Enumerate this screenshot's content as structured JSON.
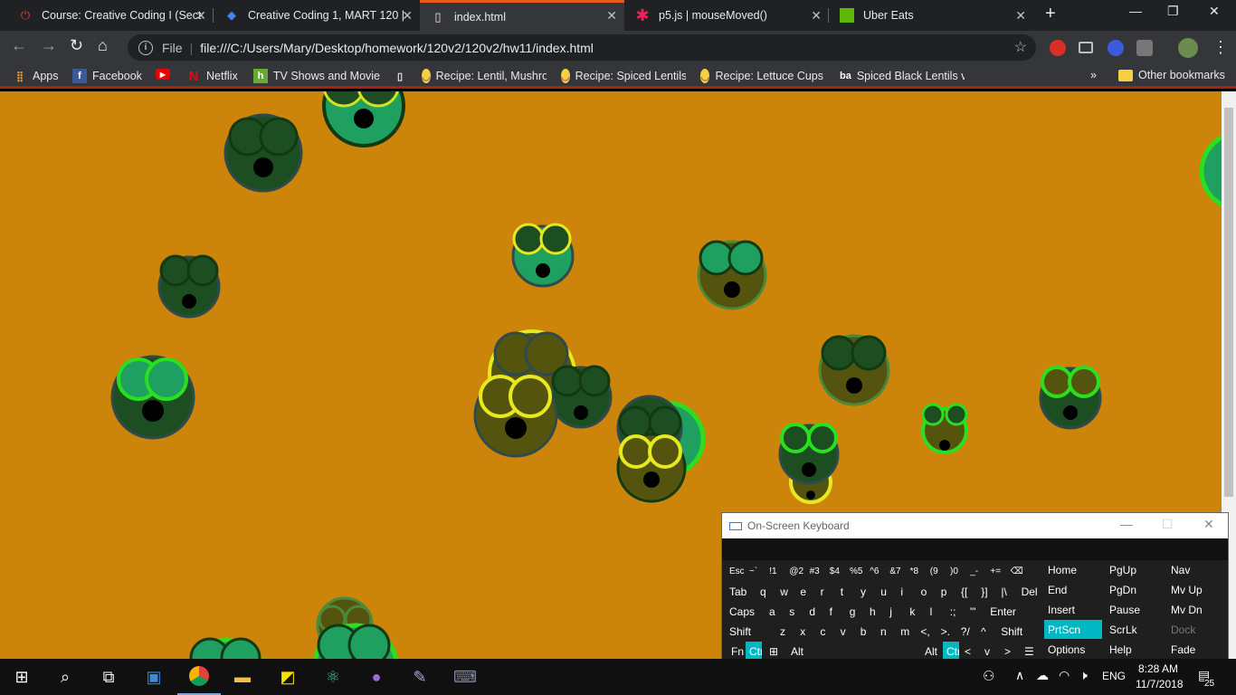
{
  "tabs": [
    {
      "title": "Course: Creative Coding I (Sect",
      "icon": "power-icon",
      "color": "#e53935",
      "active": false
    },
    {
      "title": "Creative Coding 1, MART 120 |",
      "icon": "drive-icon",
      "color": "#4285f4",
      "active": false
    },
    {
      "title": "index.html",
      "icon": "file-icon",
      "color": "#e8eaed",
      "active": true
    },
    {
      "title": "p5.js | mouseMoved()",
      "icon": "asterisk-icon",
      "color": "#ed225d",
      "active": false
    },
    {
      "title": "Uber Eats",
      "icon": "uber-eats-icon",
      "color": "#5fb709",
      "active": false
    }
  ],
  "toolbar": {
    "url_scheme_label": "File",
    "url": "file:///C:/Users/Mary/Desktop/homework/120v2/120v2/hw11/index.html"
  },
  "bookmarks": [
    {
      "label": "Apps",
      "icon": "apps-grid-icon"
    },
    {
      "label": "Facebook",
      "icon": "facebook-icon"
    },
    {
      "label": "",
      "icon": "youtube-icon"
    },
    {
      "label": "Netflix",
      "icon": "netflix-icon"
    },
    {
      "label": "TV Shows and Movie",
      "icon": "hulu-icon"
    },
    {
      "label": "",
      "icon": "page-icon"
    },
    {
      "label": "Recipe: Lentil, Mushro",
      "icon": "recipe-icon"
    },
    {
      "label": "Recipe: Spiced Lentils",
      "icon": "recipe-icon"
    },
    {
      "label": "Recipe: Lettuce Cups",
      "icon": "recipe-icon"
    },
    {
      "label": "Spiced Black Lentils v",
      "icon": "ba-icon"
    }
  ],
  "other_bookmarks": "Other bookmarks",
  "bookmarks_overflow": "»",
  "canvas": {
    "background": "#cc840a"
  },
  "osk": {
    "title": "On-Screen Keyboard",
    "rows": [
      [
        "Esc",
        "~`",
        "!1",
        "@2",
        "#3",
        "$4",
        "%5",
        "^6",
        "&7",
        "*8",
        "(9",
        ")0",
        "_-",
        "+=",
        "⌫"
      ],
      [
        "Tab",
        "q",
        "w",
        "e",
        "r",
        "t",
        "y",
        "u",
        "i",
        "o",
        "p",
        "{[",
        "}]",
        "|\\",
        "Del"
      ],
      [
        "Caps",
        "a",
        "s",
        "d",
        "f",
        "g",
        "h",
        "j",
        "k",
        "l",
        ":;",
        "\"'",
        "Enter"
      ],
      [
        "Shift",
        "z",
        "x",
        "c",
        "v",
        "b",
        "n",
        "m",
        "<,",
        ">.",
        "?/",
        "^",
        "Shift"
      ],
      [
        "Fn",
        "Ctrl",
        "⊞",
        "Alt",
        "Alt",
        "Ctrl",
        "<",
        "v",
        ">",
        "☰"
      ]
    ],
    "nav_keys": [
      [
        "Home",
        "PgUp",
        "Nav"
      ],
      [
        "End",
        "PgDn",
        "Mv Up"
      ],
      [
        "Insert",
        "Pause",
        "Mv Dn"
      ],
      [
        "PrtScn",
        "ScrLk",
        "Dock"
      ],
      [
        "Options",
        "Help",
        "Fade"
      ]
    ]
  },
  "taskbar": {
    "language": "ENG",
    "time": "8:28 AM",
    "date": "11/7/2018",
    "notifications": "25"
  }
}
